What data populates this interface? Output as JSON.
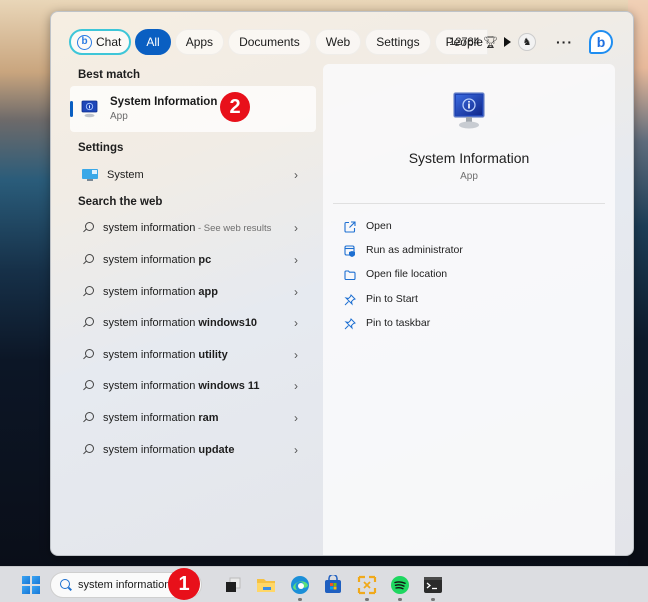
{
  "filter_bar": {
    "chat_label": "Chat",
    "tabs": [
      {
        "label": "All",
        "active": true
      },
      {
        "label": "Apps",
        "active": false
      },
      {
        "label": "Documents",
        "active": false
      },
      {
        "label": "Web",
        "active": false
      },
      {
        "label": "Settings",
        "active": false
      },
      {
        "label": "People",
        "active": false
      }
    ],
    "play_icon": "play-icon",
    "rewards_points": "12784",
    "rewards_icon": "trophy-icon",
    "more_label": "···",
    "bing_icon": "bing-chat-icon"
  },
  "results": {
    "best_match_heading": "Best match",
    "best_match": {
      "title": "System Information",
      "subtitle": "App",
      "icon": "system-information-icon"
    },
    "settings_heading": "Settings",
    "settings_items": [
      {
        "label": "System",
        "icon": "system-settings-icon"
      }
    ],
    "web_heading": "Search the web",
    "web_items": [
      {
        "prefix": "system information",
        "bold": "",
        "suffix": " - See web results"
      },
      {
        "prefix": "system information ",
        "bold": "pc",
        "suffix": ""
      },
      {
        "prefix": "system information ",
        "bold": "app",
        "suffix": ""
      },
      {
        "prefix": "system information ",
        "bold": "windows10",
        "suffix": ""
      },
      {
        "prefix": "system information ",
        "bold": "utility",
        "suffix": ""
      },
      {
        "prefix": "system information ",
        "bold": "windows 11",
        "suffix": ""
      },
      {
        "prefix": "system information ",
        "bold": "ram",
        "suffix": ""
      },
      {
        "prefix": "system information ",
        "bold": "update",
        "suffix": ""
      }
    ],
    "chevron": "›"
  },
  "detail": {
    "title": "System Information",
    "subtitle": "App",
    "actions": [
      {
        "label": "Open",
        "icon": "open-external-icon"
      },
      {
        "label": "Run as administrator",
        "icon": "run-as-admin-icon"
      },
      {
        "label": "Open file location",
        "icon": "folder-icon"
      },
      {
        "label": "Pin to Start",
        "icon": "pin-icon"
      },
      {
        "label": "Pin to taskbar",
        "icon": "pin-icon"
      }
    ]
  },
  "annotations": {
    "badge_1": "1",
    "badge_2": "2"
  },
  "taskbar": {
    "search_value": "system information",
    "apps": [
      {
        "name": "task-view",
        "running": false
      },
      {
        "name": "file-explorer",
        "running": false
      },
      {
        "name": "edge",
        "running": true
      },
      {
        "name": "microsoft-store",
        "running": false
      },
      {
        "name": "snip-tool",
        "running": true
      },
      {
        "name": "spotify",
        "running": true
      },
      {
        "name": "terminal",
        "running": true
      }
    ]
  },
  "colors": {
    "accent": "#0a5fc2",
    "annotation_red": "#e8101a",
    "chat_border": "#3ec6d8"
  }
}
